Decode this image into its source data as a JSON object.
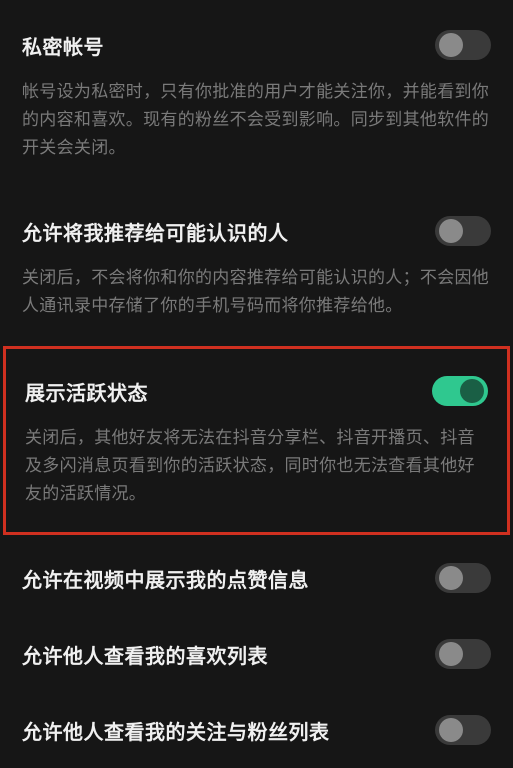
{
  "settings": [
    {
      "title": "私密帐号",
      "description": "帐号设为私密时，只有你批准的用户才能关注你，并能看到你的内容和喜欢。现有的粉丝不会受到影响。同步到其他软件的开关会关闭。",
      "toggled": false,
      "highlighted": false
    },
    {
      "title": "允许将我推荐给可能认识的人",
      "description": "关闭后，不会将你和你的内容推荐给可能认识的人；不会因他人通讯录中存储了你的手机号码而将你推荐给他。",
      "toggled": false,
      "highlighted": false
    },
    {
      "title": "展示活跃状态",
      "description": "关闭后，其他好友将无法在抖音分享栏、抖音开播页、抖音及多闪消息页看到你的活跃状态，同时你也无法查看其他好友的活跃情况。",
      "toggled": true,
      "highlighted": true
    },
    {
      "title": "允许在视频中展示我的点赞信息",
      "description": "",
      "toggled": false,
      "highlighted": false
    },
    {
      "title": "允许他人查看我的喜欢列表",
      "description": "",
      "toggled": false,
      "highlighted": false
    },
    {
      "title": "允许他人查看我的关注与粉丝列表",
      "description": "",
      "toggled": false,
      "highlighted": false
    }
  ]
}
